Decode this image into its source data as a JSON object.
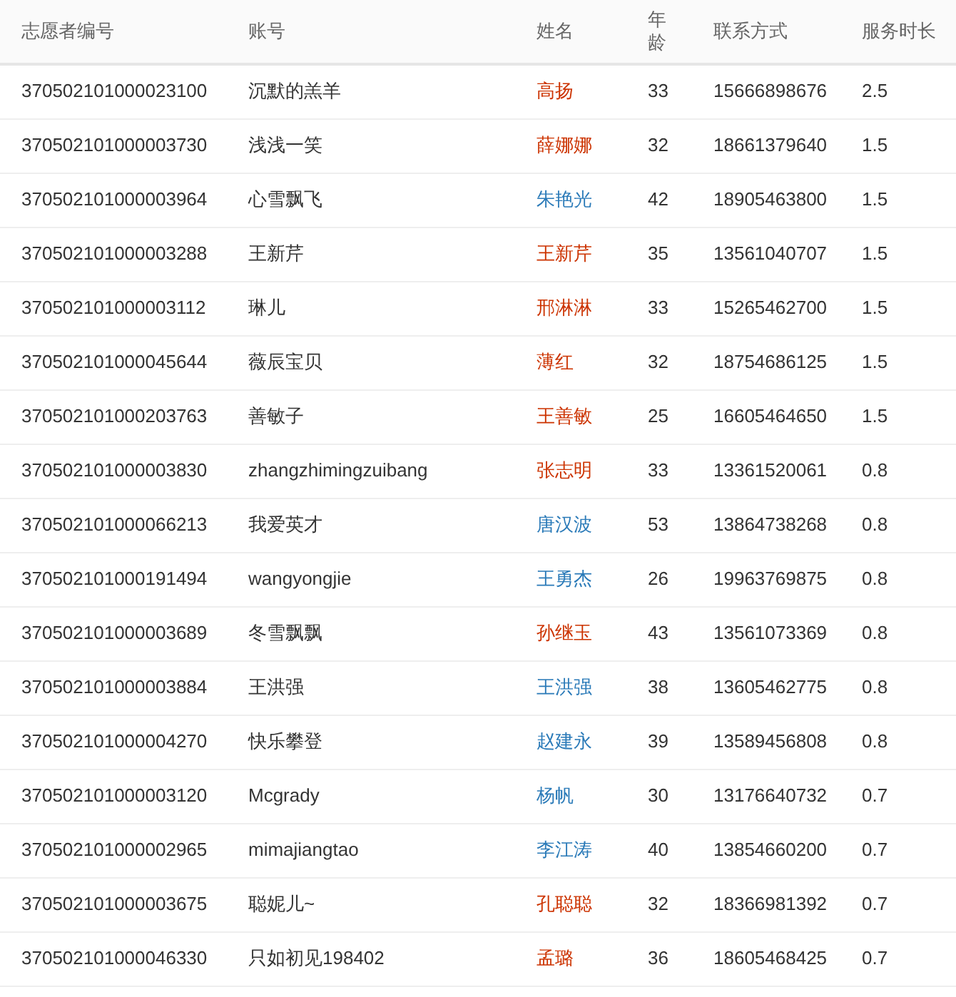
{
  "table": {
    "columns": [
      "志愿者编号",
      "账号",
      "姓名",
      "年龄",
      "联系方式",
      "服务时长"
    ],
    "rows": [
      {
        "id": "370502101000023100",
        "account": "沉默的羔羊",
        "name": "高扬",
        "color": "#cc3300",
        "age": "33",
        "phone": "15666898676",
        "hours": "2.5"
      },
      {
        "id": "370502101000003730",
        "account": "浅浅一笑",
        "name": "薛娜娜",
        "color": "#cc3300",
        "age": "32",
        "phone": "18661379640",
        "hours": "1.5"
      },
      {
        "id": "370502101000003964",
        "account": "心雪飘飞",
        "name": "朱艳光",
        "color": "#2a7ab8",
        "age": "42",
        "phone": "18905463800",
        "hours": "1.5"
      },
      {
        "id": "370502101000003288",
        "account": "王新芹",
        "name": "王新芹",
        "color": "#cc3300",
        "age": "35",
        "phone": "13561040707",
        "hours": "1.5"
      },
      {
        "id": "370502101000003112",
        "account": "琳儿",
        "name": "邢淋淋",
        "color": "#cc3300",
        "age": "33",
        "phone": "15265462700",
        "hours": "1.5"
      },
      {
        "id": "370502101000045644",
        "account": "薇辰宝贝",
        "name": "薄红",
        "color": "#cc3300",
        "age": "32",
        "phone": "18754686125",
        "hours": "1.5"
      },
      {
        "id": "370502101000203763",
        "account": "善敏子",
        "name": "王善敏",
        "color": "#cc3300",
        "age": "25",
        "phone": "16605464650",
        "hours": "1.5"
      },
      {
        "id": "370502101000003830",
        "account": "zhangzhimingzuibang",
        "name": "张志明",
        "color": "#cc3300",
        "age": "33",
        "phone": "13361520061",
        "hours": "0.8"
      },
      {
        "id": "370502101000066213",
        "account": "我爱英才",
        "name": "唐汉波",
        "color": "#2a7ab8",
        "age": "53",
        "phone": "13864738268",
        "hours": "0.8"
      },
      {
        "id": "370502101000191494",
        "account": "wangyongjie",
        "name": "王勇杰",
        "color": "#2a7ab8",
        "age": "26",
        "phone": "19963769875",
        "hours": "0.8"
      },
      {
        "id": "370502101000003689",
        "account": "冬雪飘飘",
        "name": "孙继玉",
        "color": "#cc3300",
        "age": "43",
        "phone": "13561073369",
        "hours": "0.8"
      },
      {
        "id": "370502101000003884",
        "account": "王洪强",
        "name": "王洪强",
        "color": "#2a7ab8",
        "age": "38",
        "phone": "13605462775",
        "hours": "0.8"
      },
      {
        "id": "370502101000004270",
        "account": "快乐攀登",
        "name": "赵建永",
        "color": "#2a7ab8",
        "age": "39",
        "phone": "13589456808",
        "hours": "0.8"
      },
      {
        "id": "370502101000003120",
        "account": "Mcgrady",
        "name": "杨帆",
        "color": "#2a7ab8",
        "age": "30",
        "phone": "13176640732",
        "hours": "0.7"
      },
      {
        "id": "370502101000002965",
        "account": "mimajiangtao",
        "name": "李江涛",
        "color": "#2a7ab8",
        "age": "40",
        "phone": "13854660200",
        "hours": "0.7"
      },
      {
        "id": "370502101000003675",
        "account": "聪妮儿~",
        "name": "孔聪聪",
        "color": "#cc3300",
        "age": "32",
        "phone": "18366981392",
        "hours": "0.7"
      },
      {
        "id": "370502101000046330",
        "account": "只如初见198402",
        "name": "孟璐",
        "color": "#cc3300",
        "age": "36",
        "phone": "18605468425",
        "hours": "0.7"
      }
    ]
  }
}
